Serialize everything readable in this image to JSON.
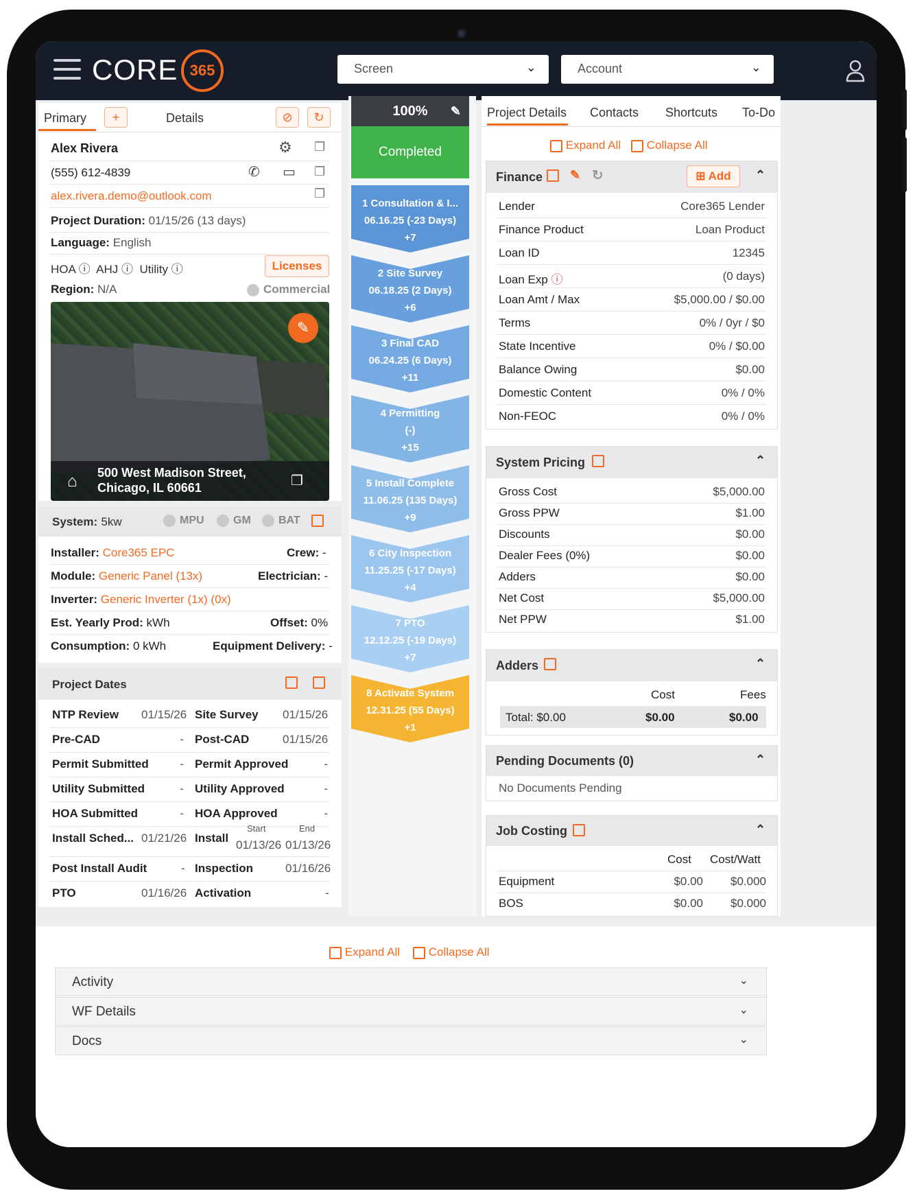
{
  "app": {
    "logo_text": "CORE",
    "logo_badge": "365"
  },
  "topbar": {
    "screen_select": "Screen",
    "account_select": "Account"
  },
  "left": {
    "tabs": {
      "primary": "Primary",
      "details": "Details"
    },
    "contact": {
      "name": "Alex Rivera",
      "phone": "(555) 612-4839",
      "email": "alex.rivera.demo@outlook.com"
    },
    "duration_label": "Project Duration:",
    "duration_value": "01/15/26 (13 days)",
    "language_label": "Language:",
    "language_value": "English",
    "hoa": "HOA",
    "ahj": "AHJ",
    "utility": "Utility",
    "licenses_btn": "Licenses",
    "region_label": "Region:",
    "region_value": "N/A",
    "commercial": "Commercial",
    "address_line1": "500 West Madison Street,",
    "address_line2": "Chicago, IL 60661",
    "system": {
      "label": "System:",
      "size": "5kw",
      "mpu": "MPU",
      "gm": "GM",
      "bat": "BAT"
    },
    "installer_label": "Installer:",
    "installer_value": "Core365 EPC",
    "crew_label": "Crew:",
    "crew_value": "-",
    "module_label": "Module:",
    "module_value": "Generic Panel",
    "module_qty": "(13x)",
    "electrician_label": "Electrician:",
    "electrician_value": "-",
    "inverter_label": "Inverter:",
    "inverter_value": "Generic Inverter",
    "inverter_qty": "(1x)",
    "inverter_qty2": "(0x)",
    "yearly_label": "Est. Yearly Prod:",
    "yearly_value": "kWh",
    "offset_label": "Offset:",
    "offset_value": "0%",
    "consumption_label": "Consumption:",
    "consumption_value": "0 kWh",
    "delivery_label": "Equipment Delivery:",
    "delivery_value": "-",
    "dates_title": "Project Dates",
    "dates": [
      {
        "l1": "NTP Review",
        "v1": "01/15/26",
        "l2": "Site Survey",
        "v2": "01/15/26"
      },
      {
        "l1": "Pre-CAD",
        "v1": "-",
        "l2": "Post-CAD",
        "v2": "01/15/26"
      },
      {
        "l1": "Permit Submitted",
        "v1": "-",
        "l2": "Permit Approved",
        "v2": "-"
      },
      {
        "l1": "Utility Submitted",
        "v1": "-",
        "l2": "Utility Approved",
        "v2": "-"
      },
      {
        "l1": "HOA Submitted",
        "v1": "-",
        "l2": "HOA Approved",
        "v2": "-"
      }
    ],
    "install_sched_label": "Install Sched...",
    "install_sched_value": "01/21/26",
    "install_label": "Install",
    "start_label": "Start",
    "end_label": "End",
    "start_value": "01/13/26",
    "end_value": "01/13/26",
    "post_audit_label": "Post Install Audit",
    "post_audit_value": "-",
    "inspection_label": "Inspection",
    "inspection_value": "01/16/26",
    "pto_label": "PTO",
    "pto_value": "01/16/26",
    "activation_label": "Activation",
    "activation_value": "-"
  },
  "progress": {
    "percent": "100%",
    "status": "Completed",
    "stages": [
      {
        "l1": "1 Consultation & I...",
        "l2": "06.16.25 (-23 Days)",
        "l3": "+7",
        "color": "#5b95d6"
      },
      {
        "l1": "2 Site Survey",
        "l2": "06.18.25 (2 Days)",
        "l3": "+6",
        "color": "#67a0dc"
      },
      {
        "l1": "3 Final CAD",
        "l2": "06.24.25 (6 Days)",
        "l3": "+11",
        "color": "#74aae1"
      },
      {
        "l1": "4 Permitting",
        "l2": "(-)",
        "l3": "+15",
        "color": "#82b4e6"
      },
      {
        "l1": "5 Install Complete",
        "l2": "11.06.25 (135 Days)",
        "l3": "+9",
        "color": "#8fbdea"
      },
      {
        "l1": "6 City Inspection",
        "l2": "11.25.25 (-17 Days)",
        "l3": "+4",
        "color": "#9cc6ee"
      },
      {
        "l1": "7 PTO",
        "l2": "12.12.25 (-19 Days)",
        "l3": "+7",
        "color": "#a9cff2"
      },
      {
        "l1": "8 Activate System",
        "l2": "12.31.25 (55 Days)",
        "l3": "+1",
        "color": "#f5b532"
      }
    ]
  },
  "right": {
    "tabs": [
      "Project Details",
      "Contacts",
      "Shortcuts",
      "To-Do"
    ],
    "expand_all": "Expand All",
    "collapse_all": "Collapse All",
    "finance": {
      "title": "Finance",
      "add": "Add",
      "rows": [
        {
          "k": "Lender",
          "v": "Core365 Lender"
        },
        {
          "k": "Finance Product",
          "v": "Loan Product"
        },
        {
          "k": "Loan ID",
          "v": "12345"
        },
        {
          "k": "Loan Exp",
          "v": "(0 days)"
        },
        {
          "k": "Loan Amt / Max",
          "v": "$5,000.00 / $0.00"
        },
        {
          "k": "Terms",
          "v": "0% / 0yr / $0"
        },
        {
          "k": "State Incentive",
          "v": "0% / $0.00"
        },
        {
          "k": "Balance Owing",
          "v": "$0.00"
        },
        {
          "k": "Domestic Content",
          "v": "0% / 0%"
        },
        {
          "k": "Non-FEOC",
          "v": "0% / 0%"
        }
      ]
    },
    "pricing": {
      "title": "System Pricing",
      "rows": [
        {
          "k": "Gross Cost",
          "v": "$5,000.00"
        },
        {
          "k": "Gross PPW",
          "v": "$1.00"
        },
        {
          "k": "Discounts",
          "v": "$0.00"
        },
        {
          "k": "Dealer Fees (0%)",
          "v": "$0.00"
        },
        {
          "k": "Adders",
          "v": "$0.00"
        },
        {
          "k": "Net Cost",
          "v": "$5,000.00"
        },
        {
          "k": "Net PPW",
          "v": "$1.00"
        }
      ]
    },
    "adders": {
      "title": "Adders",
      "cost_h": "Cost",
      "fees_h": "Fees",
      "total": "Total: $0.00",
      "cost": "$0.00",
      "fees": "$0.00"
    },
    "pending": {
      "title": "Pending Documents (0)",
      "empty": "No Documents Pending"
    },
    "costing": {
      "title": "Job Costing",
      "cost_h": "Cost",
      "watt_h": "Cost/Watt",
      "rows": [
        {
          "k": "Equipment",
          "c": "$0.00",
          "w": "$0.000"
        },
        {
          "k": "BOS",
          "c": "$0.00",
          "w": "$0.000"
        }
      ]
    }
  },
  "bottom": {
    "expand_all": "Expand All",
    "collapse_all": "Collapse All",
    "sections": [
      "Activity",
      "WF Details",
      "Docs"
    ]
  }
}
